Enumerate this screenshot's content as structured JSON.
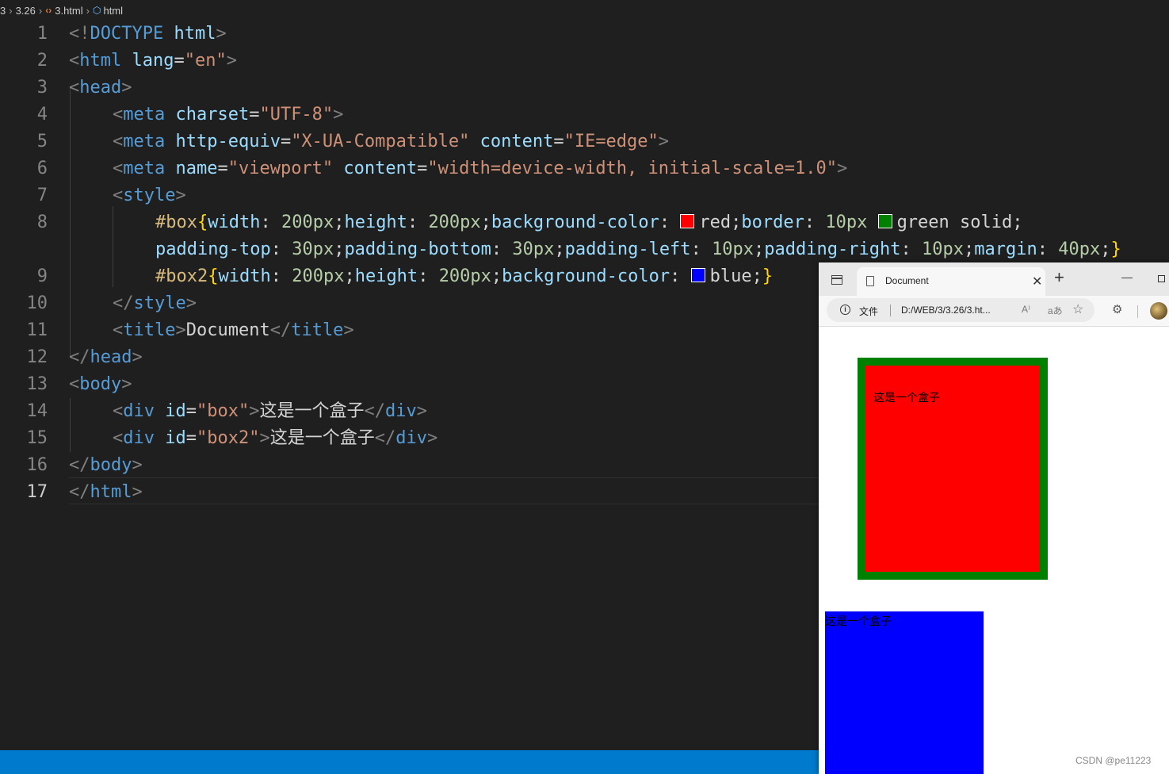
{
  "breadcrumb": {
    "items": [
      "3",
      "3.26",
      "3.html",
      "html"
    ]
  },
  "editor": {
    "line_numbers": [
      "1",
      "2",
      "3",
      "4",
      "5",
      "6",
      "7",
      "8",
      "",
      "9",
      "10",
      "11",
      "12",
      "13",
      "14",
      "15",
      "16",
      "17"
    ],
    "active_line": "17",
    "code": {
      "l1": {
        "open": "<!",
        "doctype": "DOCTYPE",
        "html": "html",
        "close": ">"
      },
      "l2": {
        "lt": "<",
        "tag": "html",
        "attr": "lang",
        "eq": "=",
        "val": "\"en\"",
        "gt": ">"
      },
      "l3": {
        "lt": "<",
        "tag": "head",
        "gt": ">"
      },
      "l4": {
        "lt": "<",
        "tag": "meta",
        "attr": "charset",
        "eq": "=",
        "val": "\"UTF-8\"",
        "gt": ">"
      },
      "l5": {
        "lt": "<",
        "tag": "meta",
        "attr1": "http-equiv",
        "eq1": "=",
        "val1": "\"X-UA-Compatible\"",
        "attr2": "content",
        "eq2": "=",
        "val2": "\"IE=edge\"",
        "gt": ">"
      },
      "l6": {
        "lt": "<",
        "tag": "meta",
        "attr1": "name",
        "eq1": "=",
        "val1": "\"viewport\"",
        "attr2": "content",
        "eq2": "=",
        "val2": "\"width=device-width, initial-scale=1.0\"",
        "gt": ">"
      },
      "l7": {
        "lt": "<",
        "tag": "style",
        "gt": ">"
      },
      "l8a": {
        "sel": "#box",
        "brace": "{",
        "p1": "width",
        "c1": ": ",
        "v1": "200px",
        "s1": ";",
        "p2": "height",
        "c2": ": ",
        "v2": "200px",
        "s2": ";",
        "p3": "background-color",
        "c3": ": ",
        "v3": "red",
        "s3": ";",
        "p4": "border",
        "c4": ": ",
        "v4n": "10px",
        "v4": "green solid",
        "s4": ";"
      },
      "l8b": {
        "p1": "padding-top",
        "c1": ": ",
        "v1": "30px",
        "s1": ";",
        "p2": "padding-bottom",
        "c2": ": ",
        "v2": "30px",
        "s2": ";",
        "p3": "padding-left",
        "c3": ": ",
        "v3": "10px",
        "s3": ";",
        "p4": "padding-right",
        "c4": ": ",
        "v4": "10px",
        "s4": ";",
        "p5": "margin",
        "c5": ": ",
        "v5": "40px",
        "s5": ";",
        "brace": "}"
      },
      "l9": {
        "sel": "#box2",
        "brace_open": "{",
        "p1": "width",
        "c1": ": ",
        "v1": "200px",
        "s1": ";",
        "p2": "height",
        "c2": ": ",
        "v2": "200px",
        "s2": ";",
        "p3": "background-color",
        "c3": ": ",
        "v3": "blue",
        "s3": ";",
        "brace_close": "}"
      },
      "l10": {
        "lt": "</",
        "tag": "style",
        "gt": ">"
      },
      "l11": {
        "lt": "<",
        "tag": "title",
        "gt": ">",
        "text": "Document",
        "lt2": "</",
        "tag2": "title",
        "gt2": ">"
      },
      "l12": {
        "lt": "</",
        "tag": "head",
        "gt": ">"
      },
      "l13": {
        "lt": "<",
        "tag": "body",
        "gt": ">"
      },
      "l14": {
        "lt": "<",
        "tag": "div",
        "attr": "id",
        "eq": "=",
        "val": "\"box\"",
        "gt": ">",
        "text": "这是一个盒子",
        "lt2": "</",
        "tag2": "div",
        "gt2": ">"
      },
      "l15": {
        "lt": "<",
        "tag": "div",
        "attr": "id",
        "eq": "=",
        "val": "\"box2\"",
        "gt": ">",
        "text": "这是一个盒子",
        "lt2": "</",
        "tag2": "div",
        "gt2": ">"
      },
      "l16": {
        "lt": "</",
        "tag": "body",
        "gt": ">"
      },
      "l17": {
        "lt": "</",
        "tag": "html",
        "gt": ">"
      }
    },
    "swatch_colors": {
      "red": "#ff0000",
      "green": "#008000",
      "blue": "#0000ff"
    }
  },
  "browser": {
    "tab_title": "Document",
    "new_tab_symbol": "+",
    "close_symbol": "✕",
    "minimize_symbol": "—",
    "address": {
      "scheme_label": "文件",
      "url": "D:/WEB/3/3.26/3.ht..."
    },
    "page": {
      "box_text": "这是一个盒子",
      "box2_text": "这是一个盒子"
    }
  },
  "watermark": "CSDN @pe11223",
  "colors": {
    "editor_bg": "#1f1f1f",
    "statusbar": "#007acc",
    "tag": "#569cd6",
    "attr": "#9cdcfe",
    "string": "#ce9178",
    "number": "#b5cea8",
    "selector": "#d7ba7d"
  }
}
